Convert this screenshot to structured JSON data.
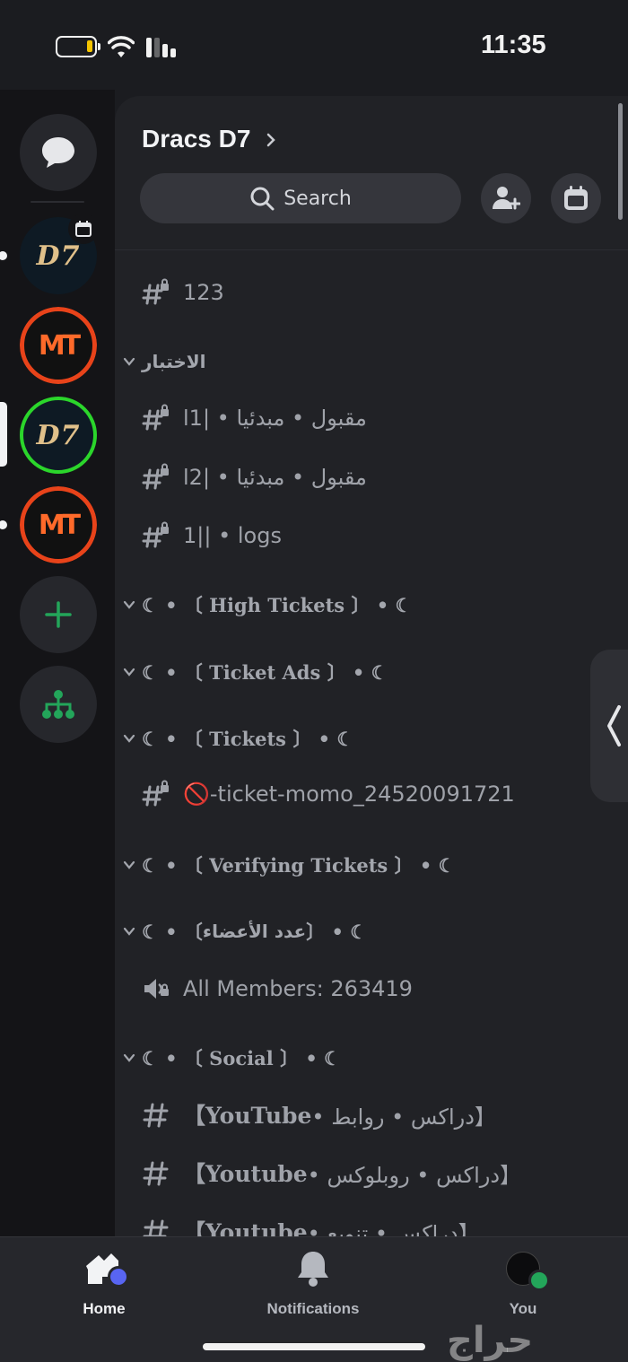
{
  "status_bar": {
    "time": "11:35"
  },
  "server": {
    "name": "Dracs D7",
    "search_label": "Search"
  },
  "rail": {
    "logos": {
      "d7": "D7",
      "mt": "MT"
    }
  },
  "channels": {
    "top_channel": "123",
    "cat_1": "الاختبار",
    "ch_1": "مقبول • مبدئيا • |1ا",
    "ch_2": "مقبول • مبدئيا • |2ا",
    "ch_3": "1|| • logs",
    "cat_2": "☾ • 〔 High Tickets 〕 • ☾",
    "cat_3": "☾ • 〔 Ticket Ads 〕 • ☾",
    "cat_4": "☾ • 〔 Tickets 〕 • ☾",
    "ch_ticket": "🚫-ticket-momo_24520091721",
    "cat_5": "☾ • 〔 Verifying Tickets 〕 • ☾",
    "cat_6_prefix": "☾ • 〔 ",
    "cat_6_ar": "عدد الأعضاء",
    "cat_6_suffix": " 〕 • ☾",
    "ch_members": "All Members: 263419",
    "cat_7": "☾ • 〔 Social 〕 • ☾",
    "social_1_en": "【YouTube",
    "social_1_ar": " • دراكس • روابط】",
    "social_2_en": "【Youtube",
    "social_2_ar": " • دراكس • روبلوكس】",
    "social_3_en": "【Youtube",
    "social_3_ar": " • دراكس • تنويع】"
  },
  "bottom_nav": {
    "home": "Home",
    "notifications": "Notifications",
    "you": "You"
  },
  "watermark": "حراج",
  "colors": {
    "background": "#1b1c20",
    "panel": "#212226",
    "rail": "#141417",
    "accent_green": "#23a55a",
    "accent_blurple": "#5865f2",
    "battery_yellow": "#f5c400"
  },
  "icons": [
    "battery-icon",
    "wifi-icon",
    "signal-icon",
    "dm-chat-icon",
    "calendar-icon",
    "add-server-icon",
    "hub-icon",
    "search-icon",
    "invite-icon",
    "event-calendar-icon",
    "locked-hash-icon",
    "locked-voice-icon",
    "hash-icon",
    "caret-down-icon",
    "collapse-panel-icon",
    "home-icon",
    "bell-icon",
    "avatar-icon"
  ]
}
